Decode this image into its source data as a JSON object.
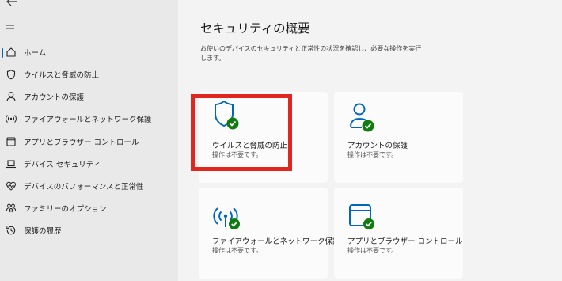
{
  "sidebar": {
    "items": [
      {
        "icon": "home-icon",
        "label": "ホーム",
        "active": true
      },
      {
        "icon": "shield-icon",
        "label": "ウイルスと脅威の防止",
        "active": false
      },
      {
        "icon": "person-icon",
        "label": "アカウントの保護",
        "active": false
      },
      {
        "icon": "wifi-icon",
        "label": "ファイアウォールとネットワーク保護",
        "active": false
      },
      {
        "icon": "app-window-icon",
        "label": "アプリとブラウザー コントロール",
        "active": false
      },
      {
        "icon": "laptop-icon",
        "label": "デバイス セキュリティ",
        "active": false
      },
      {
        "icon": "heart-icon",
        "label": "デバイスのパフォーマンスと正常性",
        "active": false
      },
      {
        "icon": "family-icon",
        "label": "ファミリーのオプション",
        "active": false
      },
      {
        "icon": "history-icon",
        "label": "保護の履歴",
        "active": false
      }
    ]
  },
  "main": {
    "title": "セキュリティの概要",
    "description": "お使いのデバイスのセキュリティと正常性の状況を確認し、必要な操作を実行します。",
    "tiles": [
      {
        "icon": "shield-check-icon",
        "title": "ウイルスと脅威の防止",
        "status": "操作は不要です。"
      },
      {
        "icon": "account-check-icon",
        "title": "アカウントの保護",
        "status": "操作は不要です。"
      },
      {
        "icon": "wifi-check-icon",
        "title": "ファイアウォールとネットワーク保護",
        "status": "操作は不要です。"
      },
      {
        "icon": "browser-check-icon",
        "title": "アプリとブラウザー コントロール",
        "status": "操作は不要です。"
      }
    ]
  },
  "colors": {
    "accent": "#0067c0",
    "ok": "#107c10",
    "highlight": "#e0261f"
  }
}
